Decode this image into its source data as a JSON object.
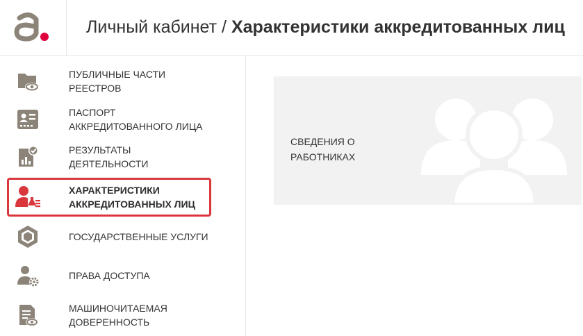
{
  "header": {
    "crumb": "Личный кабинет",
    "separator": " / ",
    "title": "Характеристики аккредитованных лиц"
  },
  "colors": {
    "accent": "#d9373c",
    "icon": "#8c8479",
    "card_bg": "#f2f2f2",
    "card_icon": "#ffffff"
  },
  "sidebar": {
    "items": [
      {
        "line1": "ПУБЛИЧНЫЕ ЧАСТИ",
        "line2": "РЕЕСТРОВ",
        "icon": "folder-eye-icon",
        "active": false
      },
      {
        "line1": "ПАСПОРТ",
        "line2": "АККРЕДИТОВАННОГО ЛИЦА",
        "icon": "id-card-icon",
        "active": false
      },
      {
        "line1": "РЕЗУЛЬТАТЫ ДЕЯТЕЛЬНОСТИ",
        "line2": "",
        "icon": "chart-check-icon",
        "active": false
      },
      {
        "line1": "ХАРАКТЕРИСТИКИ",
        "line2": "АККРЕДИТОВАННЫХ ЛИЦ",
        "icon": "person-flask-icon",
        "active": true
      },
      {
        "line1": "ГОСУДАРСТВЕННЫЕ УСЛУГИ",
        "line2": "",
        "icon": "hexagon-icon",
        "active": false
      },
      {
        "line1": "ПРАВА ДОСТУПА",
        "line2": "",
        "icon": "user-gear-icon",
        "active": false
      },
      {
        "line1": "МАШИНОЧИТАЕМАЯ",
        "line2": "ДОВЕРЕННОСТЬ",
        "icon": "document-eye-icon",
        "active": false
      }
    ]
  },
  "main": {
    "cards": [
      {
        "line1": "СВЕДЕНИЯ О",
        "line2": "РАБОТНИКАХ",
        "icon": "people-group-icon"
      }
    ]
  }
}
